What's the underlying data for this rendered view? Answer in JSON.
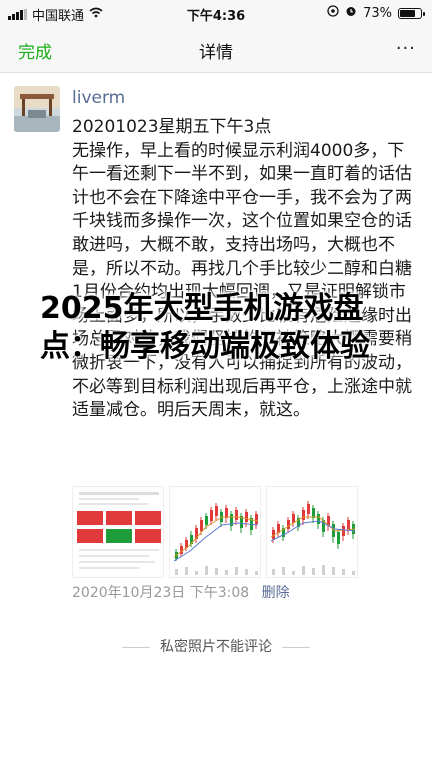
{
  "status_bar": {
    "carrier": "中国联通",
    "time": "下午4:36",
    "battery": "73%",
    "battery_level": 0.73
  },
  "nav": {
    "done_label": "完成",
    "title": "详情",
    "more_label": "···"
  },
  "post": {
    "username": "liverm",
    "body": "20201023星期五下午3点\n无操作，早上看的时候显示利润4000多，下午一看还剩下一半不到，如果一直盯着的话估计也不会在下降途中平仓一手，我不会为了两千块钱而多操作一次，这个位置如果空仓的话敢进吗，大概不敢，支持出场吗，大概也不是，所以不动。再找几个手比较少二醇和白糖1月份合约均出现大幅回调，又是证明解锁市场上面多，所以，手数少比较有危险边缘时出场总是对的，我们坚持的不被策略大概需要稍微折衷一下，没有人可以捕捉到所有的波动，不必等到目标利润出现后再平仓，上涨途中就适量减仓。明后天周末，就这。",
    "time": "2020年10月23日 下午3:08",
    "delete_label": "删除",
    "thumbnail_icons": [
      "trading-app-screenshot",
      "stock-chart-screenshot",
      "stock-chart-screenshot"
    ]
  },
  "footer": {
    "private_note": "私密照片不能评论"
  },
  "overlay": {
    "text": "2025年大型手机游戏盘点：畅享移动端极致体验"
  },
  "colors": {
    "wechat_green": "#1aad19",
    "link_blue": "#576b95",
    "up_red": "#e03a3a",
    "down_green": "#1f9d3a"
  }
}
